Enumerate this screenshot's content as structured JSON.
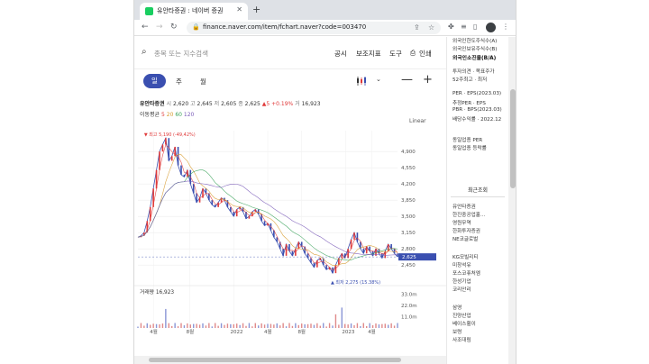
{
  "browser": {
    "tab_title": "유안타증권 : 네이버 증권",
    "url": "finance.naver.com/item/fchart.naver?code=003470"
  },
  "toolbar": {
    "search_placeholder": "종목 또는 지수검색",
    "menu": [
      "공시",
      "보조지표",
      "도구",
      "인쇄"
    ]
  },
  "period": {
    "day": "일",
    "week": "주",
    "month": "월"
  },
  "stock": {
    "name": "유안타증권",
    "open_label": "시",
    "open": "2,620",
    "high_label": "고",
    "high": "2,645",
    "low_label": "저",
    "low": "2,605",
    "close_label": "종",
    "close": "2,625",
    "change": "▲5",
    "change_pct": "+0.19%",
    "vol_label": "거",
    "volume": "16,923"
  },
  "ma": {
    "label": "이동평균",
    "values": [
      "5",
      "20",
      "60",
      "120"
    ],
    "colors": [
      "#e03a3a",
      "#d89b2e",
      "#3aa35a",
      "#7a5bb8"
    ]
  },
  "scale": "Linear",
  "chart_data": {
    "type": "line",
    "title": "",
    "y_ticks": [
      2450,
      2800,
      3150,
      3500,
      3850,
      4200,
      4550,
      4900
    ],
    "y_tick_labels": [
      "2,450",
      "2,800",
      "3,150",
      "3,500",
      "3,850",
      "4,200",
      "4,550",
      "4,900"
    ],
    "ylim": [
      2200,
      5350
    ],
    "x_tick_labels": [
      "4월",
      "8월",
      "2022",
      "4월",
      "8월",
      "2023",
      "4월"
    ],
    "x_tick_pos": [
      0.06,
      0.2,
      0.37,
      0.5,
      0.63,
      0.8,
      0.9
    ],
    "current_price": "2,625",
    "max_label": "최고 5,190 (-49,42%)",
    "min_label": "최저 2,275 (15.38%)",
    "price_path": [
      3050,
      3080,
      3150,
      3400,
      3700,
      4100,
      4500,
      4900,
      5050,
      5190,
      4700,
      4800,
      5000,
      4600,
      4400,
      4350,
      4500,
      4200,
      4000,
      3800,
      3900,
      4100,
      4000,
      3850,
      3750,
      3700,
      3800,
      3900,
      3850,
      3700,
      3600,
      3500,
      3650,
      3700,
      3600,
      3450,
      3500,
      3600,
      3650,
      3550,
      3400,
      3300,
      3350,
      3200,
      3050,
      2950,
      2800,
      2650,
      2900,
      2750,
      2650,
      2800,
      2950,
      2850,
      2700,
      2600,
      2500,
      2400,
      2550,
      2600,
      2450,
      2350,
      2400,
      2275,
      2450,
      2600,
      2700,
      2600,
      2800,
      3000,
      3150,
      2950,
      2800,
      2700,
      2850,
      2750,
      2650,
      2800,
      2700,
      2600,
      2750,
      2900,
      2800,
      2700,
      2625
    ],
    "volume_label": "거래량",
    "volume_value": "16,923",
    "volume_ticks": [
      "33.0m",
      "22.0m",
      "11.0m"
    ],
    "volume_ylim": [
      0,
      38
    ]
  },
  "sidebar": {
    "items_top": [
      "외국인한도주식수(A)",
      "외국인보유주식수(B)",
      "외국인소진율(B/A)"
    ],
    "invest": [
      "투자의견 · 목표주가",
      "52주최고 · 최저"
    ],
    "ratios": [
      "PER · EPS(2023.03)",
      "추정PER · EPS",
      "PBR · BPS(2023.03)",
      "배당수익률 · 2022.12"
    ],
    "sector": [
      "동일업종 PER",
      "동일업종 등락률"
    ],
    "recent_tab": "최근조회",
    "recent": [
      "유안타증권",
      "한진중공업홀...",
      "영원무역",
      "한화투자증권",
      "NE코글로벌"
    ],
    "recent2": [
      "KG모빌리티",
      "미창석유",
      "포스코퓨처엠",
      "한성기업",
      "코리안리"
    ],
    "recent3": [
      "삼영",
      "진양산업",
      "베이스휠이",
      "보령",
      "사조대림"
    ]
  }
}
